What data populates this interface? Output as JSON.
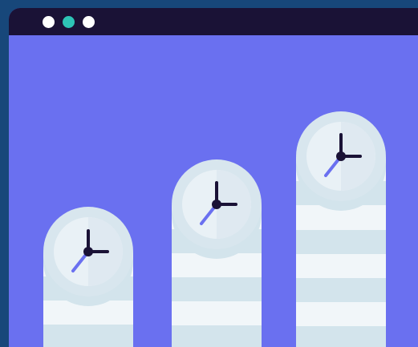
{
  "window": {
    "background": "#6a70f0",
    "titlebar_color": "#1a1236",
    "controls": [
      {
        "name": "close-control",
        "color": "#ffffff"
      },
      {
        "name": "minimize-control",
        "color": "#2ec4b6"
      },
      {
        "name": "maximize-control",
        "color": "#ffffff"
      }
    ]
  },
  "illustration": {
    "icons": [
      "clock-icon",
      "clock-icon",
      "clock-icon"
    ],
    "colors": {
      "stripe_light": "#f1f6f9",
      "stripe_dark": "#d3e4ec",
      "clock_rim": "#d8e6ee",
      "clock_face": "#e9f1f6",
      "hand_dark": "#1a1236",
      "hand_accent": "#6a70f0"
    }
  }
}
